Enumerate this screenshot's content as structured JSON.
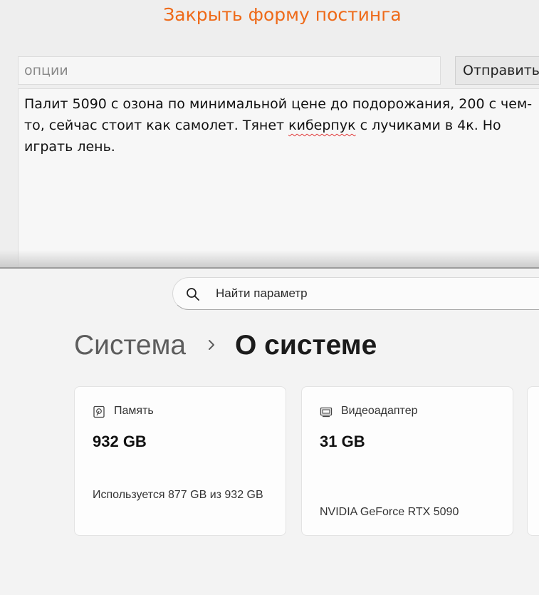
{
  "posting_form": {
    "close_link": "Закрыть форму постинга",
    "options_placeholder": "опции",
    "submit_label": "Отправить",
    "message_before_misspelled": "Палит 5090 с озона по минимальной цене до подорожания, 200 с чем-то, сейчас стоит как самолет. Тянет ",
    "message_misspelled": "киберпук",
    "message_after_misspelled": " с лучиками в 4к. Но играть лень."
  },
  "settings": {
    "search_placeholder": "Найти параметр",
    "breadcrumb": {
      "parent": "Система",
      "current": "О системе"
    },
    "cards": {
      "memory": {
        "icon": "storage-icon",
        "label": "Память",
        "value": "932 GB",
        "description": "Используется 877 GB из 932 GB"
      },
      "gpu": {
        "icon": "display-adapter-icon",
        "label": "Видеоадаптер",
        "value": "31 GB",
        "description": "NVIDIA GeForce RTX 5090"
      }
    }
  },
  "colors": {
    "accent_link": "#ee6a19",
    "spellcheck_underline": "#e03b3b"
  }
}
